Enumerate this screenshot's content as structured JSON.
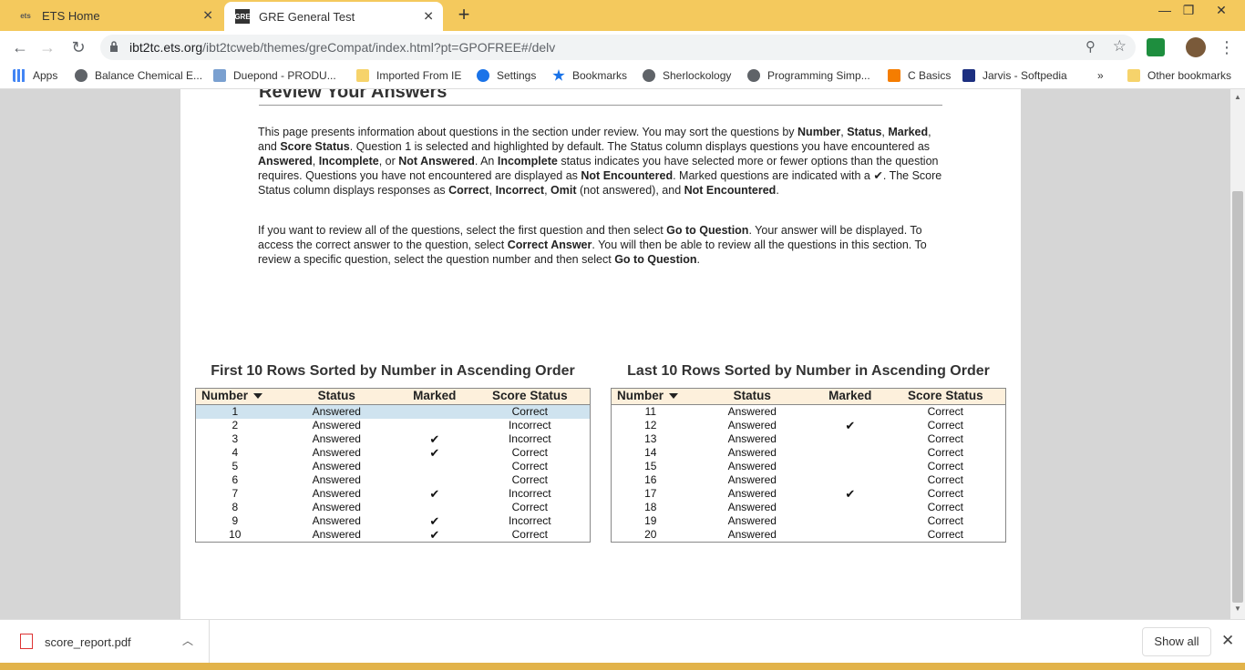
{
  "browser": {
    "tabs": [
      {
        "label": "ETS Home",
        "favicon": "ets-logo-icon"
      },
      {
        "label": "GRE General Test",
        "favicon": "gre-icon"
      }
    ],
    "url_host": "ibt2tc.ets.org",
    "url_path": "/ibt2tcweb/themes/greCompat/index.html?pt=GPOFREE#/delv",
    "bookmarks": [
      {
        "label": "Apps",
        "icon": "apps-grid-icon"
      },
      {
        "label": "Balance Chemical E...",
        "icon": "globe-icon"
      },
      {
        "label": "Duepond - PRODU...",
        "icon": "page-icon"
      },
      {
        "label": "Imported From IE",
        "icon": "folder-icon"
      },
      {
        "label": "Settings",
        "icon": "gear-icon"
      },
      {
        "label": "Bookmarks",
        "icon": "star-icon"
      },
      {
        "label": "Sherlockology",
        "icon": "globe-icon"
      },
      {
        "label": "Programming Simp...",
        "icon": "globe-icon"
      },
      {
        "label": "C Basics",
        "icon": "blogger-icon"
      },
      {
        "label": "Jarvis - Softpedia",
        "icon": "softpedia-icon"
      },
      {
        "label": "»",
        "icon": "overflow-icon"
      },
      {
        "label": "Other bookmarks",
        "icon": "folder-icon"
      }
    ]
  },
  "page": {
    "heading": "Review Your Answers",
    "para1": [
      {
        "t": "This page presents information about questions in the section under review. You may sort the questions by "
      },
      {
        "t": "Number",
        "b": true
      },
      {
        "t": ", "
      },
      {
        "t": "Status",
        "b": true
      },
      {
        "t": ", "
      },
      {
        "t": "Marked",
        "b": true
      },
      {
        "t": ", and "
      },
      {
        "t": "Score Status",
        "b": true
      },
      {
        "t": ". Question 1 is selected and highlighted by default. The Status column displays questions you have encountered as "
      },
      {
        "t": "Answered",
        "b": true
      },
      {
        "t": ", "
      },
      {
        "t": "Incomplete",
        "b": true
      },
      {
        "t": ", or "
      },
      {
        "t": "Not Answered",
        "b": true
      },
      {
        "t": ". An "
      },
      {
        "t": "Incomplete",
        "b": true
      },
      {
        "t": " status indicates you have selected more or fewer options than the question requires. Questions you have not encountered are displayed as "
      },
      {
        "t": "Not Encountered",
        "b": true
      },
      {
        "t": ". Marked questions are indicated with a "
      },
      {
        "t": "✔",
        "b": true
      },
      {
        "t": ". The Score Status column displays responses as "
      },
      {
        "t": "Correct",
        "b": true
      },
      {
        "t": ", "
      },
      {
        "t": "Incorrect",
        "b": true
      },
      {
        "t": ", "
      },
      {
        "t": "Omit",
        "b": true
      },
      {
        "t": " (not answered), and "
      },
      {
        "t": "Not Encountered",
        "b": true
      },
      {
        "t": "."
      }
    ],
    "para2": [
      {
        "t": "If you want to review all of the questions, select the first question and then select "
      },
      {
        "t": "Go to Question",
        "b": true
      },
      {
        "t": ". Your answer will be displayed. To access the correct answer to the question, select "
      },
      {
        "t": "Correct Answer",
        "b": true
      },
      {
        "t": ". You will then be able to review all the questions in this section. To review a specific question, select the question number and then select "
      },
      {
        "t": "Go to Question",
        "b": true
      },
      {
        "t": "."
      }
    ]
  },
  "columns": [
    "Number",
    "Status",
    "Marked",
    "Score Status"
  ],
  "tables": [
    {
      "title": "First 10 Rows Sorted by Number in Ascending Order",
      "rows": [
        {
          "n": "1",
          "status": "Answered",
          "marked": false,
          "score": "Correct",
          "selected": true
        },
        {
          "n": "2",
          "status": "Answered",
          "marked": false,
          "score": "Incorrect"
        },
        {
          "n": "3",
          "status": "Answered",
          "marked": true,
          "score": "Incorrect"
        },
        {
          "n": "4",
          "status": "Answered",
          "marked": true,
          "score": "Correct"
        },
        {
          "n": "5",
          "status": "Answered",
          "marked": false,
          "score": "Correct"
        },
        {
          "n": "6",
          "status": "Answered",
          "marked": false,
          "score": "Correct"
        },
        {
          "n": "7",
          "status": "Answered",
          "marked": true,
          "score": "Incorrect"
        },
        {
          "n": "8",
          "status": "Answered",
          "marked": false,
          "score": "Correct"
        },
        {
          "n": "9",
          "status": "Answered",
          "marked": true,
          "score": "Incorrect"
        },
        {
          "n": "10",
          "status": "Answered",
          "marked": true,
          "score": "Correct"
        }
      ]
    },
    {
      "title": "Last 10 Rows Sorted by Number in Ascending Order",
      "rows": [
        {
          "n": "11",
          "status": "Answered",
          "marked": false,
          "score": "Correct"
        },
        {
          "n": "12",
          "status": "Answered",
          "marked": true,
          "score": "Correct"
        },
        {
          "n": "13",
          "status": "Answered",
          "marked": false,
          "score": "Correct"
        },
        {
          "n": "14",
          "status": "Answered",
          "marked": false,
          "score": "Correct"
        },
        {
          "n": "15",
          "status": "Answered",
          "marked": false,
          "score": "Correct"
        },
        {
          "n": "16",
          "status": "Answered",
          "marked": false,
          "score": "Correct"
        },
        {
          "n": "17",
          "status": "Answered",
          "marked": true,
          "score": "Correct"
        },
        {
          "n": "18",
          "status": "Answered",
          "marked": false,
          "score": "Correct"
        },
        {
          "n": "19",
          "status": "Answered",
          "marked": false,
          "score": "Correct"
        },
        {
          "n": "20",
          "status": "Answered",
          "marked": false,
          "score": "Correct"
        }
      ]
    }
  ],
  "check_glyph": "✔",
  "downloads": {
    "file": "score_report.pdf",
    "show_all": "Show all"
  },
  "glyphs": {
    "close": "✕",
    "plus": "+",
    "back": "←",
    "forward": "→",
    "reload": "↻",
    "minimize": "—",
    "restore": "❐",
    "window_close": "✕",
    "zoom": "⚲",
    "star": "☆",
    "menu": "⋮",
    "chevron_up": "︿"
  },
  "colors": {
    "tabstrip": "#f4c95d",
    "table_header": "#fdf0dc",
    "selected_row": "#cfe3ef"
  }
}
